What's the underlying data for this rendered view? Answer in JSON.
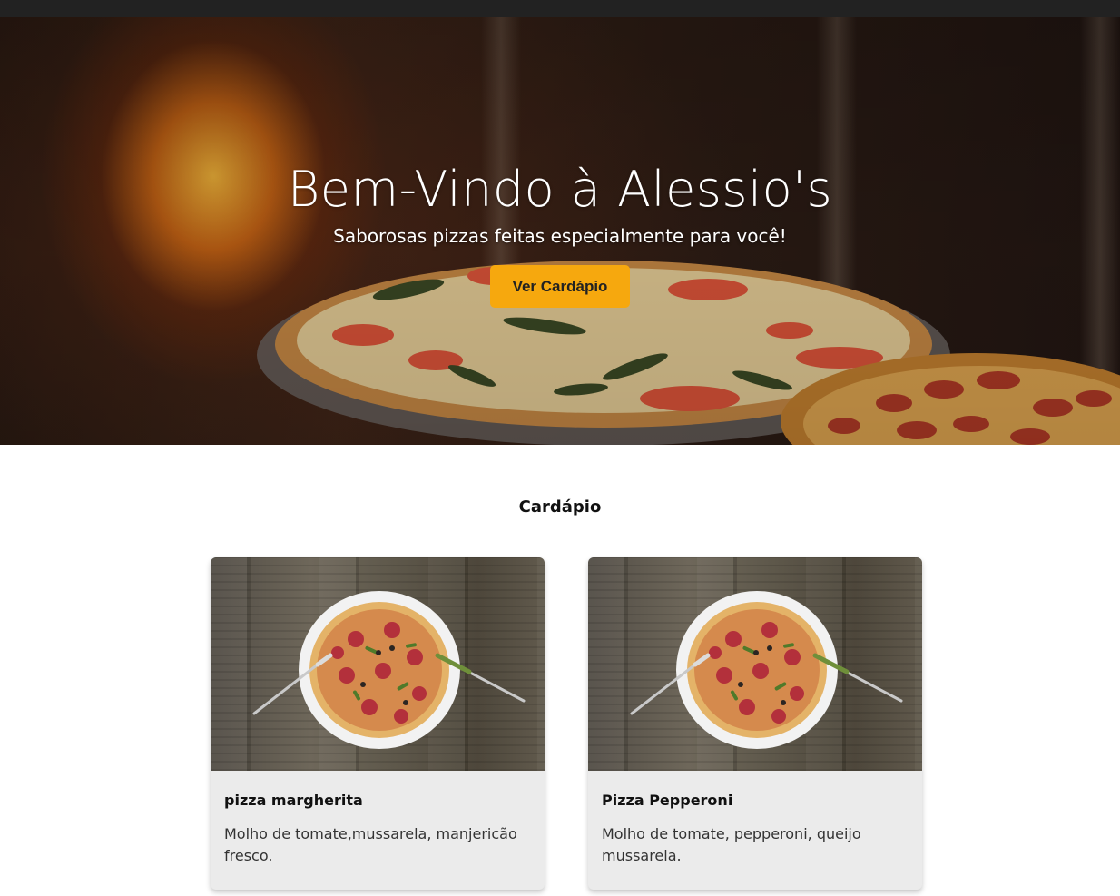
{
  "hero": {
    "title": "Bem-Vindo à Alessio's",
    "subtitle": "Saborosas pizzas feitas especialmente para você!",
    "cta_label": "Ver Cardápio"
  },
  "menu": {
    "title": "Cardápio",
    "items": [
      {
        "name": "pizza margherita",
        "description": "Molho de tomate,mussarela, manjericão fresco."
      },
      {
        "name": "Pizza Pepperoni",
        "description": "Molho de tomate, pepperoni, queijo mussarela."
      }
    ]
  },
  "colors": {
    "accent": "#f6a80e",
    "topbar": "#222222",
    "card_bg": "#ebebeb"
  }
}
